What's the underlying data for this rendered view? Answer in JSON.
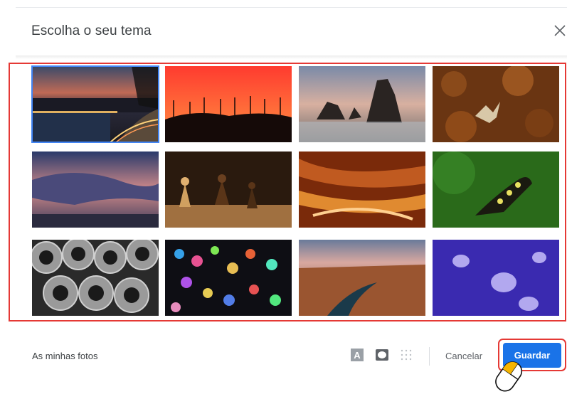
{
  "dialog": {
    "title": "Escolha o seu tema",
    "close_icon": "close-icon"
  },
  "themes": [
    {
      "name": "city-river-night",
      "selected": true
    },
    {
      "name": "wind-turbines-sunset",
      "selected": false
    },
    {
      "name": "sea-rocks",
      "selected": false
    },
    {
      "name": "autumn-leaves",
      "selected": false
    },
    {
      "name": "stormy-sky",
      "selected": false
    },
    {
      "name": "chess-pieces",
      "selected": false
    },
    {
      "name": "canyon",
      "selected": false
    },
    {
      "name": "caterpillar",
      "selected": false
    },
    {
      "name": "pipes",
      "selected": false
    },
    {
      "name": "bokeh-lights",
      "selected": false
    },
    {
      "name": "river-canyon",
      "selected": false
    },
    {
      "name": "jellyfish",
      "selected": false
    }
  ],
  "footer": {
    "my_photos": "As minhas fotos",
    "text_color_icon": "text-background-icon",
    "vignette_icon": "vignette-icon",
    "blur_icon": "blur-icon",
    "cancel_label": "Cancelar",
    "save_label": "Guardar"
  },
  "colors": {
    "accent": "#1a73e8",
    "highlight": "#e53935",
    "selection": "#4285f4"
  }
}
